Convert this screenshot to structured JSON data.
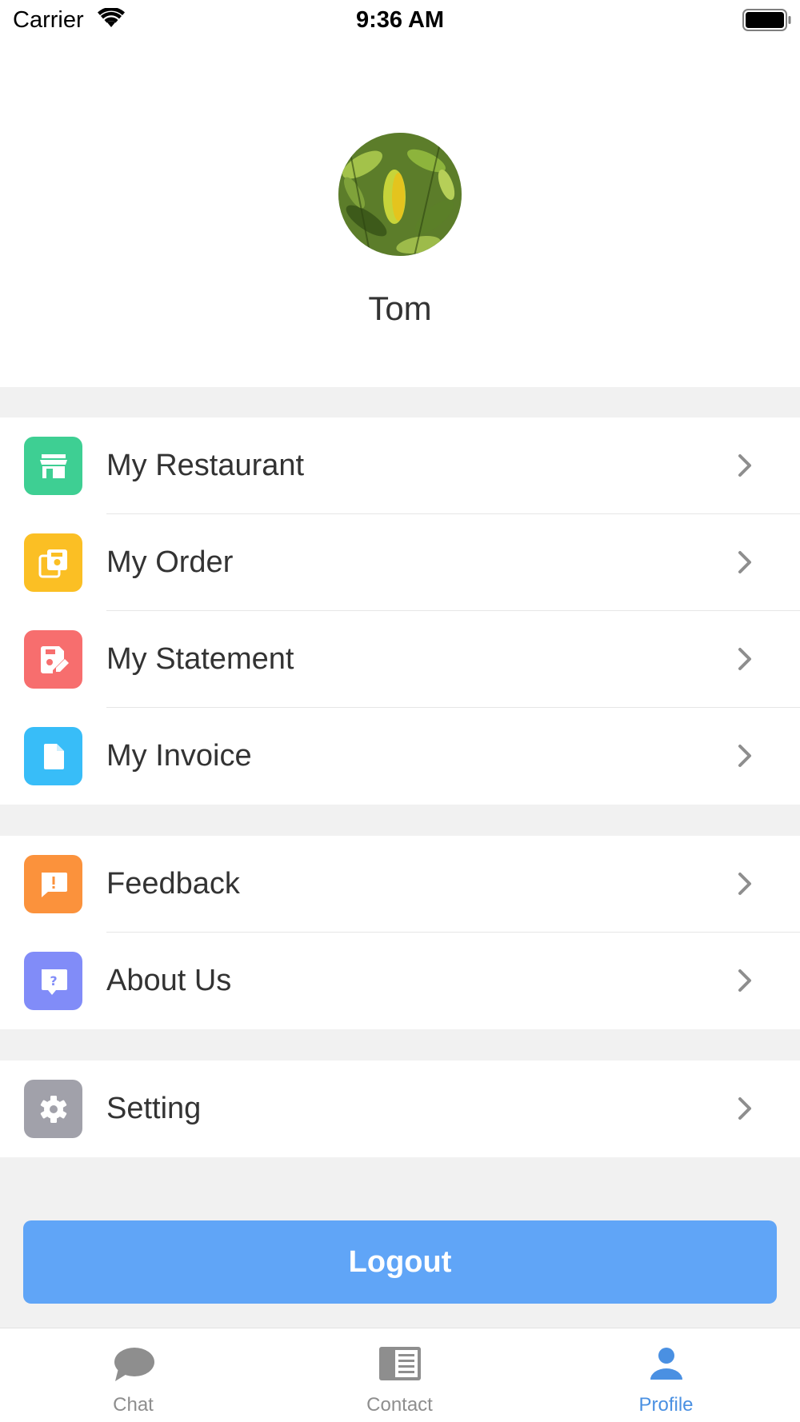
{
  "status_bar": {
    "carrier": "Carrier",
    "time": "9:36 AM"
  },
  "profile": {
    "name": "Tom",
    "avatar_icon": "avatar-leaf-photo"
  },
  "menu_groups": [
    {
      "items": [
        {
          "label": "My Restaurant",
          "icon": "store-icon",
          "color": "#3ecf93"
        },
        {
          "label": "My Order",
          "icon": "order-icon",
          "color": "#fbbf24"
        },
        {
          "label": "My Statement",
          "icon": "statement-edit-icon",
          "color": "#f76e6e"
        },
        {
          "label": "My Invoice",
          "icon": "invoice-document-icon",
          "color": "#38bdf8"
        }
      ]
    },
    {
      "items": [
        {
          "label": "Feedback",
          "icon": "feedback-icon",
          "color": "#fb923c"
        },
        {
          "label": "About Us",
          "icon": "about-question-icon",
          "color": "#818cf8"
        }
      ]
    },
    {
      "items": [
        {
          "label": "Setting",
          "icon": "gear-icon",
          "color": "#a1a1aa"
        }
      ]
    }
  ],
  "logout_label": "Logout",
  "tab_bar": {
    "tabs": [
      {
        "label": "Chat",
        "icon": "chat-bubble-icon",
        "active": false
      },
      {
        "label": "Contact",
        "icon": "contact-card-icon",
        "active": false
      },
      {
        "label": "Profile",
        "icon": "person-icon",
        "active": true
      }
    ],
    "active_color": "#4a90e2",
    "inactive_color": "#8e8e8e"
  },
  "colors": {
    "primary_button": "#60a5f7",
    "section_background": "#f1f1f1"
  }
}
